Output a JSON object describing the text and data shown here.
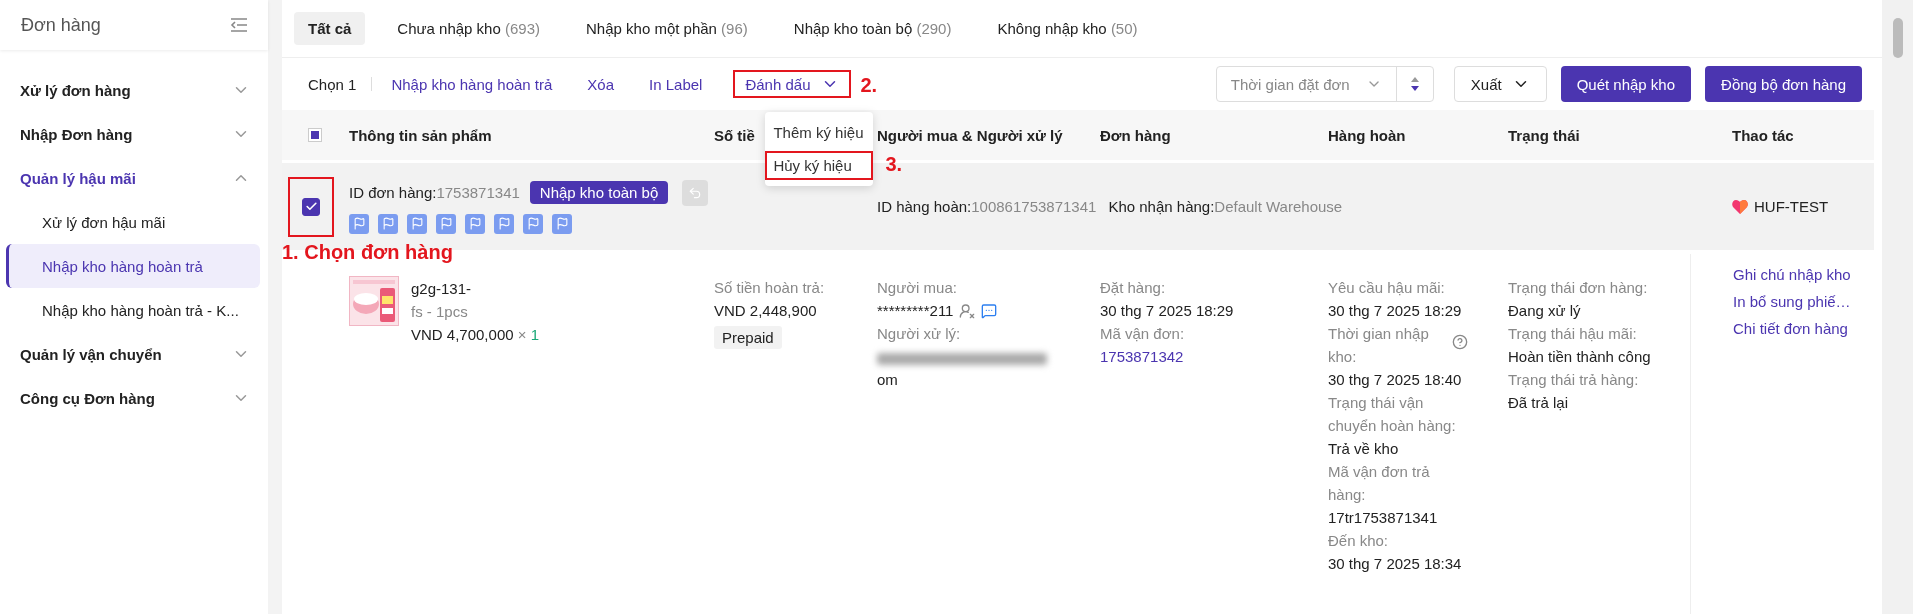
{
  "sidebar": {
    "title": "Đơn hàng",
    "items": [
      {
        "label": "Xử lý đơn hàng",
        "expanded": false
      },
      {
        "label": "Nhập Đơn hàng",
        "expanded": false
      },
      {
        "label": "Quản lý hậu mãi",
        "expanded": true,
        "children": [
          {
            "label": "Xử lý đơn hậu mãi",
            "selected": false
          },
          {
            "label": "Nhập kho hàng hoàn trả",
            "selected": true
          },
          {
            "label": "Nhập kho hàng hoàn trả - K...",
            "selected": false
          }
        ]
      },
      {
        "label": "Quản lý vận chuyển",
        "expanded": false
      },
      {
        "label": "Công cụ Đơn hàng",
        "expanded": false
      }
    ]
  },
  "tabs": [
    {
      "label": "Tất cả",
      "selected": true
    },
    {
      "label": "Chưa nhập kho",
      "count": "(693)",
      "selected": false
    },
    {
      "label": "Nhập kho một phần",
      "count": "(96)",
      "selected": false
    },
    {
      "label": "Nhập kho toàn bộ",
      "count": "(290)",
      "selected": false
    },
    {
      "label": "Không nhập kho",
      "count": "(50)",
      "selected": false
    }
  ],
  "toolbar": {
    "selection": "Chọn 1",
    "actions": [
      {
        "label": "Nhập kho hàng hoàn trả",
        "kind": "link",
        "highlighted": false
      },
      {
        "label": "Xóa",
        "kind": "link",
        "highlighted": false
      },
      {
        "label": "In Label",
        "kind": "link",
        "highlighted": false
      },
      {
        "label": "Đánh dấu",
        "kind": "dropdown",
        "highlighted": true,
        "annotation": "2.",
        "menu": [
          {
            "label": "Thêm ký hiệu",
            "highlighted": false
          },
          {
            "label": "Hủy ký hiệu",
            "highlighted": true,
            "annotation": "3."
          }
        ]
      }
    ],
    "sort_select": {
      "placeholder": "Thời gian đặt đơn"
    },
    "export": "Xuất",
    "buttons": [
      "Quét nhập kho",
      "Đồng bộ đơn hàng"
    ]
  },
  "table": {
    "header_checkbox": {
      "indeterminate": true
    },
    "columns": [
      "Thông tin sản phẩm",
      "Số tiề",
      "Người mua & Người xử lý",
      "Đơn hàng",
      "Hàng hoàn",
      "Trạng thái",
      "Thao tác"
    ],
    "orders": [
      {
        "checked": true,
        "highlighted": true,
        "annotation": "1. Chọn đơn hàng",
        "order_id_label": "ID đơn hàng:",
        "order_id": "1753871341",
        "badge": "Nhập kho toàn bộ",
        "flags": [
          {
            "kind": "flag"
          },
          {
            "kind": "flag"
          },
          {
            "kind": "flag"
          },
          {
            "kind": "flag"
          },
          {
            "kind": "flag"
          },
          {
            "kind": "flag"
          },
          {
            "kind": "flag"
          },
          {
            "kind": "flag"
          }
        ],
        "return_id_label": "ID hàng hoàn:",
        "return_id": "100861753871341",
        "warehouse_label": "Kho nhận hàng:",
        "warehouse": "Default Warehouse",
        "shop": "HUF-TEST",
        "product": {
          "name": "g2g-131-",
          "variant": "fs - 1pcs",
          "price": "VND 4,700,000",
          "times": "×",
          "quantity": "1"
        },
        "refund": {
          "label": "Số tiền hoàn trả:",
          "amount": "VND 2,448,900",
          "tag": "Prepaid"
        },
        "buyer": {
          "label": "Người mua:",
          "value": "*********211",
          "handler_label": "Người xử lý:",
          "handler_redacted": true,
          "handler_tail": "om"
        },
        "order": {
          "placed_label": "Đặt hàng:",
          "placed": "30 thg 7 2025 18:29",
          "tracking_label": "Mã vận đơn:",
          "tracking": "1753871342"
        },
        "return_fields": [
          {
            "label": "Yêu cầu hậu mãi:",
            "value": "30 thg 7 2025 18:29",
            "help": false
          },
          {
            "label": "Thời gian nhập kho:",
            "value": "30 thg 7 2025 18:40",
            "help": true
          },
          {
            "label": "Trạng thái vận chuyển hoàn hàng:",
            "value": "Trả về kho",
            "help": false
          },
          {
            "label": "Mã vận đơn trả hàng:",
            "value": "17tr1753871341",
            "help": false
          },
          {
            "label": "Đến kho:",
            "value": "30 thg 7 2025 18:34",
            "help": false
          }
        ],
        "status_fields": [
          {
            "label": "Trạng thái đơn hàng:",
            "value": "Đang xử lý"
          },
          {
            "label": "Trạng thái hậu mãi:",
            "value": "Hoàn tiền thành công"
          },
          {
            "label": "Trạng thái trả hàng:",
            "value": "Đã trả lại"
          }
        ],
        "actions": [
          "Ghi chú nhập kho",
          "In bổ sung phiế…",
          "Chi tiết đơn hàng"
        ]
      }
    ]
  }
}
